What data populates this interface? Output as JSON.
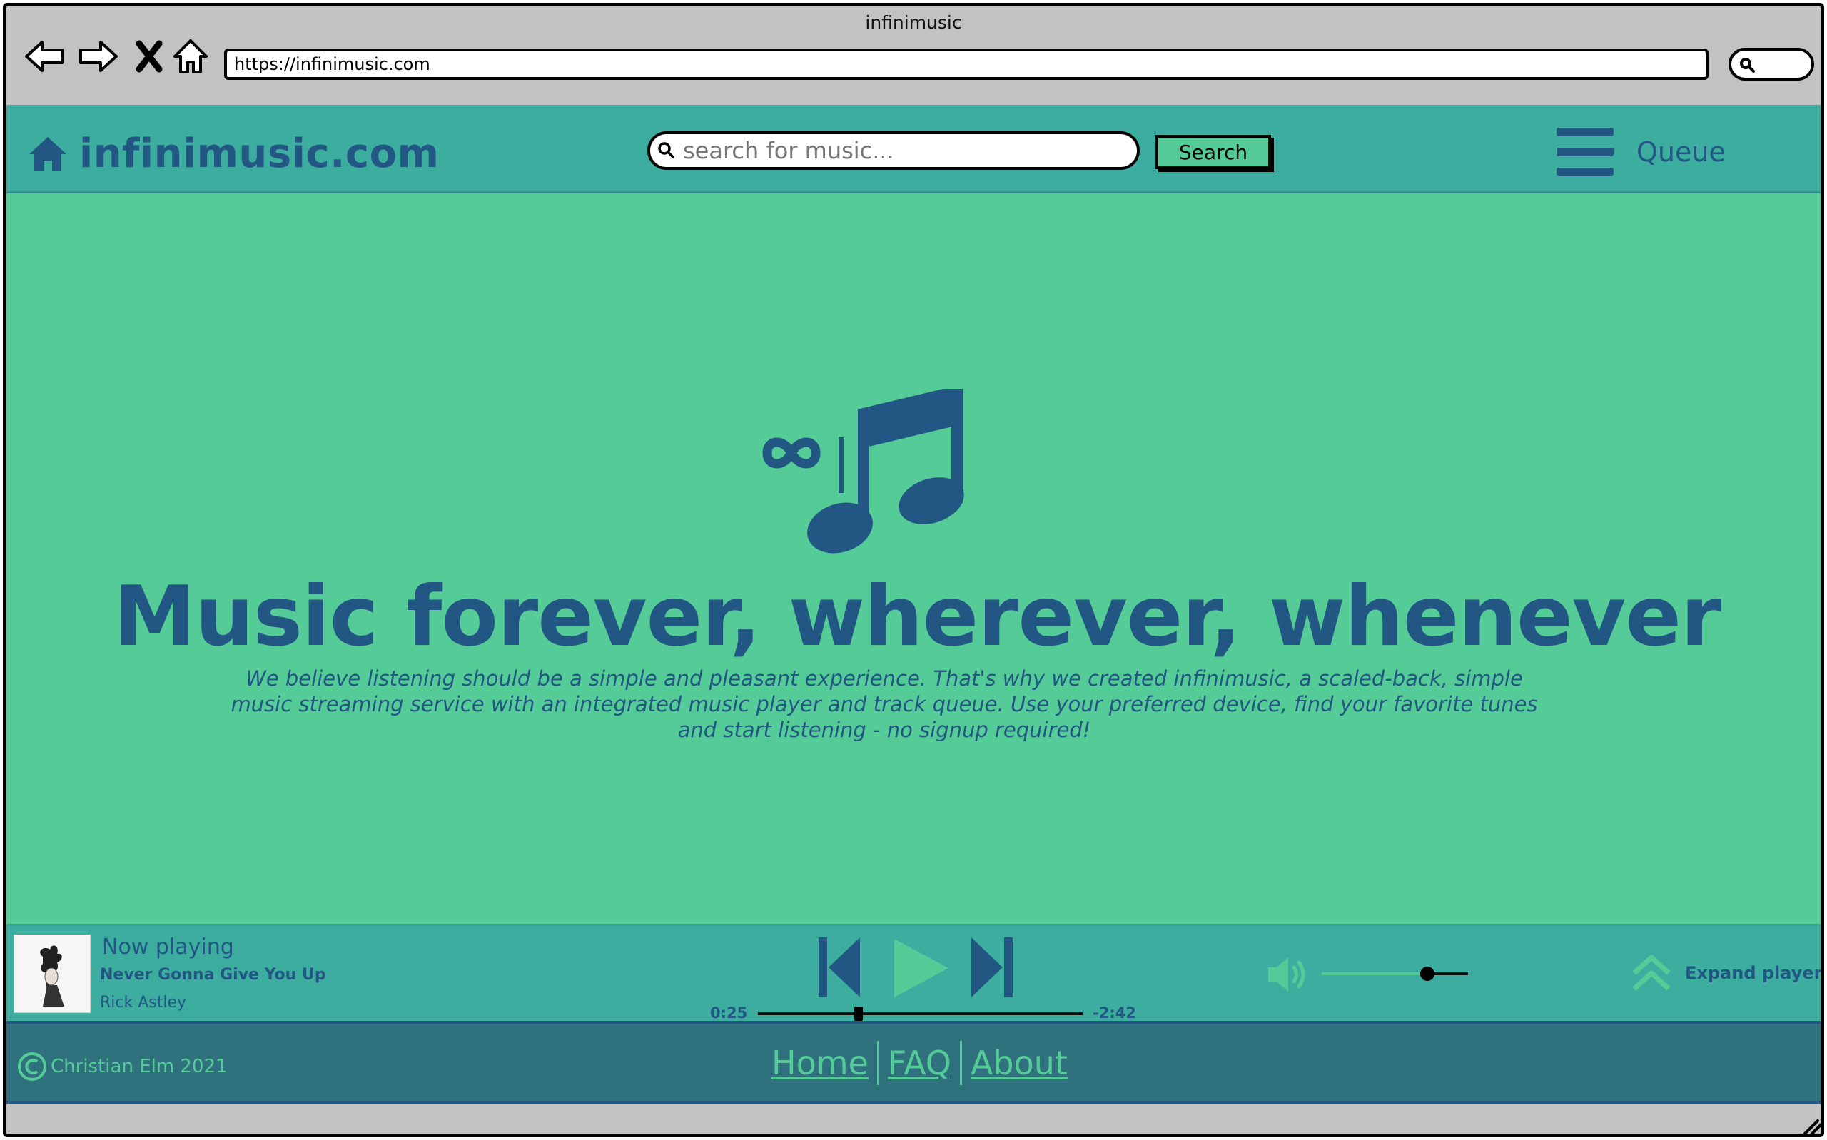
{
  "browser": {
    "window_title": "infinimusic",
    "url": "https://infinimusic.com"
  },
  "header": {
    "brand": "infinimusic.com",
    "search_placeholder": "search for music...",
    "search_button": "Search",
    "queue_label": "Queue"
  },
  "hero": {
    "title": "Music forever, wherever, whenever",
    "description": "We believe listening should be a simple and pleasant experience. That's why we created infinimusic, a scaled-back, simple music streaming service with an integrated music player and track queue. Use your preferred device, find your favorite tunes and start listening - no signup required!"
  },
  "player": {
    "now_playing_label": "Now playing",
    "track": "Never Gonna Give You Up",
    "artist": "Rick Astley",
    "elapsed": "0:25",
    "remaining": "-2:42",
    "progress_fraction": 0.31,
    "volume_fraction": 0.72,
    "expand_label": "Expand player"
  },
  "footer": {
    "copyright": "Christian Elm 2021",
    "links": [
      "Home",
      "FAQ",
      "About"
    ]
  },
  "colors": {
    "page_bg": "#55cc98",
    "bar_bg": "#3dada0",
    "footer_bg": "#2f727e",
    "brand_text": "#215782"
  }
}
